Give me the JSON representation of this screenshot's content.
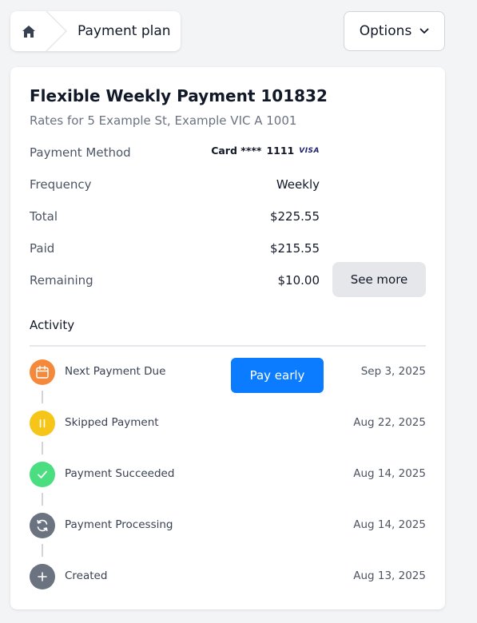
{
  "breadcrumb": {
    "home_icon": "home-icon",
    "current": "Payment plan"
  },
  "options": {
    "label": "Options",
    "icon": "chevron-down-icon"
  },
  "plan": {
    "title": "Flexible Weekly Payment 101832",
    "subtitle": "Rates for 5 Example St, Example VIC A 1001",
    "details": {
      "payment_method_label": "Payment Method",
      "card_prefix": "Card ****",
      "card_last4": "1111",
      "card_brand": "VISA",
      "frequency_label": "Frequency",
      "frequency_value": "Weekly",
      "total_label": "Total",
      "total_value": "$225.55",
      "paid_label": "Paid",
      "paid_value": "$215.55",
      "remaining_label": "Remaining",
      "remaining_value": "$10.00"
    },
    "see_more_label": "See more"
  },
  "activity": {
    "heading": "Activity",
    "pay_early_label": "Pay early",
    "items": [
      {
        "label": "Next Payment Due",
        "date": "Sep 3, 2025",
        "icon": "calendar-icon",
        "color": "#f5893b"
      },
      {
        "label": "Skipped Payment",
        "date": "Aug 22, 2025",
        "icon": "pause-icon",
        "color": "#f5c518"
      },
      {
        "label": "Payment Succeeded",
        "date": "Aug 14, 2025",
        "icon": "check-icon",
        "color": "#4ade80"
      },
      {
        "label": "Payment Processing",
        "date": "Aug 14, 2025",
        "icon": "refresh-icon",
        "color": "#6b7280"
      },
      {
        "label": "Created",
        "date": "Aug 13, 2025",
        "icon": "plus-icon",
        "color": "#6b7280"
      }
    ]
  },
  "colors": {
    "primary": "#0b7cff",
    "background": "#f3f4f6",
    "card": "#ffffff"
  }
}
